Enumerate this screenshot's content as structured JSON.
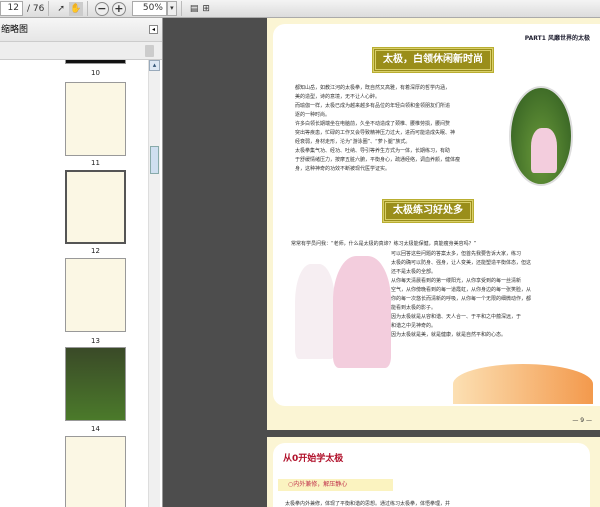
{
  "toolbar": {
    "current_page": "12",
    "total_pages": "/ 76",
    "zoom": "50%",
    "zoom_out": "−",
    "zoom_in": "+",
    "dropdown": "▾"
  },
  "sidebar": {
    "title": "缩略图",
    "close": "◂",
    "scroll_up": "▴",
    "thumbnails": [
      {
        "label": "10"
      },
      {
        "label": "11"
      },
      {
        "label": "12"
      },
      {
        "label": "13"
      },
      {
        "label": "14"
      }
    ]
  },
  "page1": {
    "part": "PART1 风靡世界的太极",
    "banner1": "太极，白领休闲新时尚",
    "paras1": [
      "都知山岳，如教江河的太极拳，既自然又高雅，有着深厚的哲学内涵，",
      "美的造型，诗的意境，无不让人心醉。",
      "而瑜伽一样，太极已成为越来越多有品位的年轻白领和金领朋友们所追",
      "逐的一种时尚。",
      "许多白领长期端坐在电脑前，久坐不动造成了颈椎、腰椎劳损，腰间赘",
      "突出等疾患，忙碌的工作又会导致精神压力过大，进而可能造成失眠、神",
      "经衰弱，身材走形，沦为“游泳圈”、“萝卜腿”族式。",
      "太极拳集气功、经功、吐纳、导引等养生方式为一体，长期练习，有助",
      "于舒缓情绪压力，按摩五脏六腑，平衡身心，疏通经络，调血养颜，健体瘦",
      "身，这种神奇的功效不断被现代医学证实。"
    ],
    "banner2": "太极练习好处多",
    "intro": "常常有学员问我：“老师，什么是太极的真谛？练习太极能保健，真能瘦身美容吗？”",
    "paras2": [
      "可以回答这些问题的答案太多，但首先我要告诉大家，练习",
      "太极的确可以防身、强身，让人变美，还能塑造平衡体态，但这",
      "还不是太极的全部。",
      "从你每天清晨看到的第一缕阳光，从你享受到的每一丝清新",
      "空气，从你傍晚看到的每一道霞虹，从你身边的每一张笑脸，从",
      "你的每一次悠长而清新的呼吸，从你每一个无限的细微动作，都",
      "能看到太极的影子。",
      "因为太极就是从容和谐、天人合一、于平和之中蕴深远，于",
      "和谐之中见神奇的。",
      "因为太极就是美，就是健康，就是自然平和的心态。"
    ],
    "page_number": "— 9 —"
  },
  "page2": {
    "title": "从0开始学太极",
    "subtitle": "○内外兼修，解压静心",
    "para": "太极拳内外兼修，体现了平衡和谐的思想。通过练习太极拳，体悟拳理，并"
  }
}
